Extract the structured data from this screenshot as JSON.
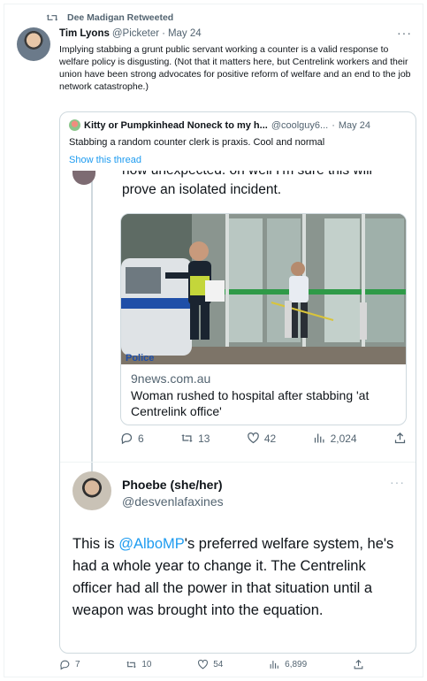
{
  "retweet": {
    "label": "Dee Madigan Retweeted"
  },
  "main_tweet": {
    "name": "Tim Lyons",
    "handle": "@Picketer",
    "sep": "·",
    "date": "May 24",
    "more": "···",
    "text": "Implying stabbing a grunt public servant working a counter is a valid response to welfare policy is disgusting. (Not that it matters here, but Centrelink workers and their union have been strong advocates for positive reform of welfare and an end to the job network catastrophe.)",
    "actions": {
      "replies": "7",
      "retweets": "10",
      "likes": "54",
      "views": "6,899"
    }
  },
  "quote": {
    "name": "Kitty or Pumpkinhead Noneck to my h...",
    "handle": "@coolguy6...",
    "sep": "·",
    "date": "May 24",
    "text": "Stabbing a random counter clerk is praxis. Cool and normal",
    "show_thread": "Show this thread"
  },
  "embedded_top": {
    "text_cut": "how unexpected. oh well I'm sure this will",
    "text": "prove an isolated incident."
  },
  "card": {
    "police_text": "Police",
    "domain": "9news.com.au",
    "title": "Woman rushed to hospital after stabbing 'at Centrelink office'",
    "actions": {
      "replies": "6",
      "retweets": "13",
      "likes": "42",
      "views": "2,024"
    }
  },
  "phoebe": {
    "name": "Phoebe (she/her)",
    "handle": "@desvenlafaxines",
    "more": "···",
    "text_before": "This is ",
    "mention": "@AlboMP",
    "text_after": "'s preferred welfare system, he's had a whole year to change it. The Centrelink officer had all the power in that situation until a weapon was brought into the equation."
  },
  "colors": {
    "link": "#1d9bf0",
    "muted": "#536471",
    "border": "#cfd9de"
  }
}
